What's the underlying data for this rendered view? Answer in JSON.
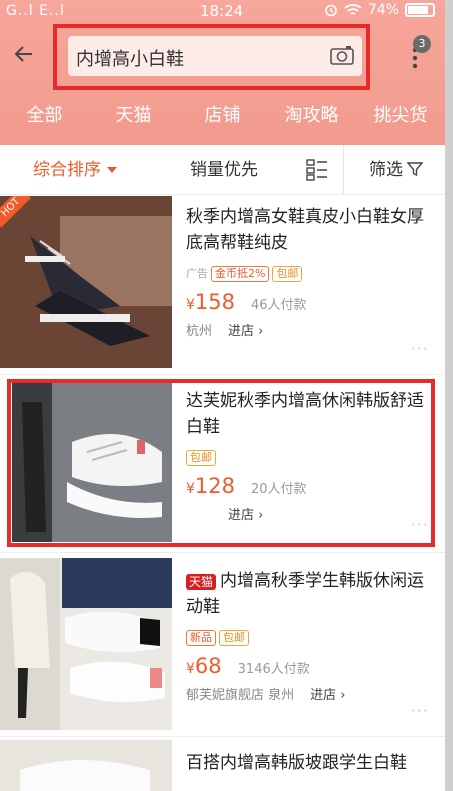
{
  "status_bar": {
    "signal_left": "G..l E..l",
    "time": "18:24",
    "battery": "74%"
  },
  "header": {
    "search_query": "内增高小白鞋",
    "badge_count": "3"
  },
  "tabs": [
    "全部",
    "天猫",
    "店铺",
    "淘攻略",
    "挑尖货"
  ],
  "sortbar": {
    "default": "综合排序",
    "sales": "销量优先",
    "filter": "筛选"
  },
  "items": [
    {
      "title": "秋季内增高女鞋真皮小白鞋女厚底高帮鞋纯皮",
      "tags": [
        "广告",
        "金币抵2%",
        "包邮"
      ],
      "price_symbol": "¥",
      "price": "158",
      "paid": "46人付款",
      "location": "杭州",
      "shop_link": "进店 ›",
      "thumb_label": "HOT"
    },
    {
      "title": "达芙妮秋季内增高休闲韩版舒适白鞋",
      "tags": [
        "包邮"
      ],
      "price_symbol": "¥",
      "price": "128",
      "paid": "20人付款",
      "location": "",
      "shop_link": "进店 ›"
    },
    {
      "tmall_tag": "天猫",
      "title": "内增高秋季学生韩版休闲运动鞋",
      "tags": [
        "新品",
        "包邮"
      ],
      "price_symbol": "¥",
      "price": "68",
      "paid": "3146人付款",
      "location": "郁芙妮旗舰店 泉州",
      "shop_link": "进店 ›"
    },
    {
      "title": "百搭内增高韩版坡跟学生白鞋"
    }
  ],
  "colors": {
    "accent": "#f25a2a",
    "header": "#f3a093",
    "highlight": "#e82a2a"
  }
}
